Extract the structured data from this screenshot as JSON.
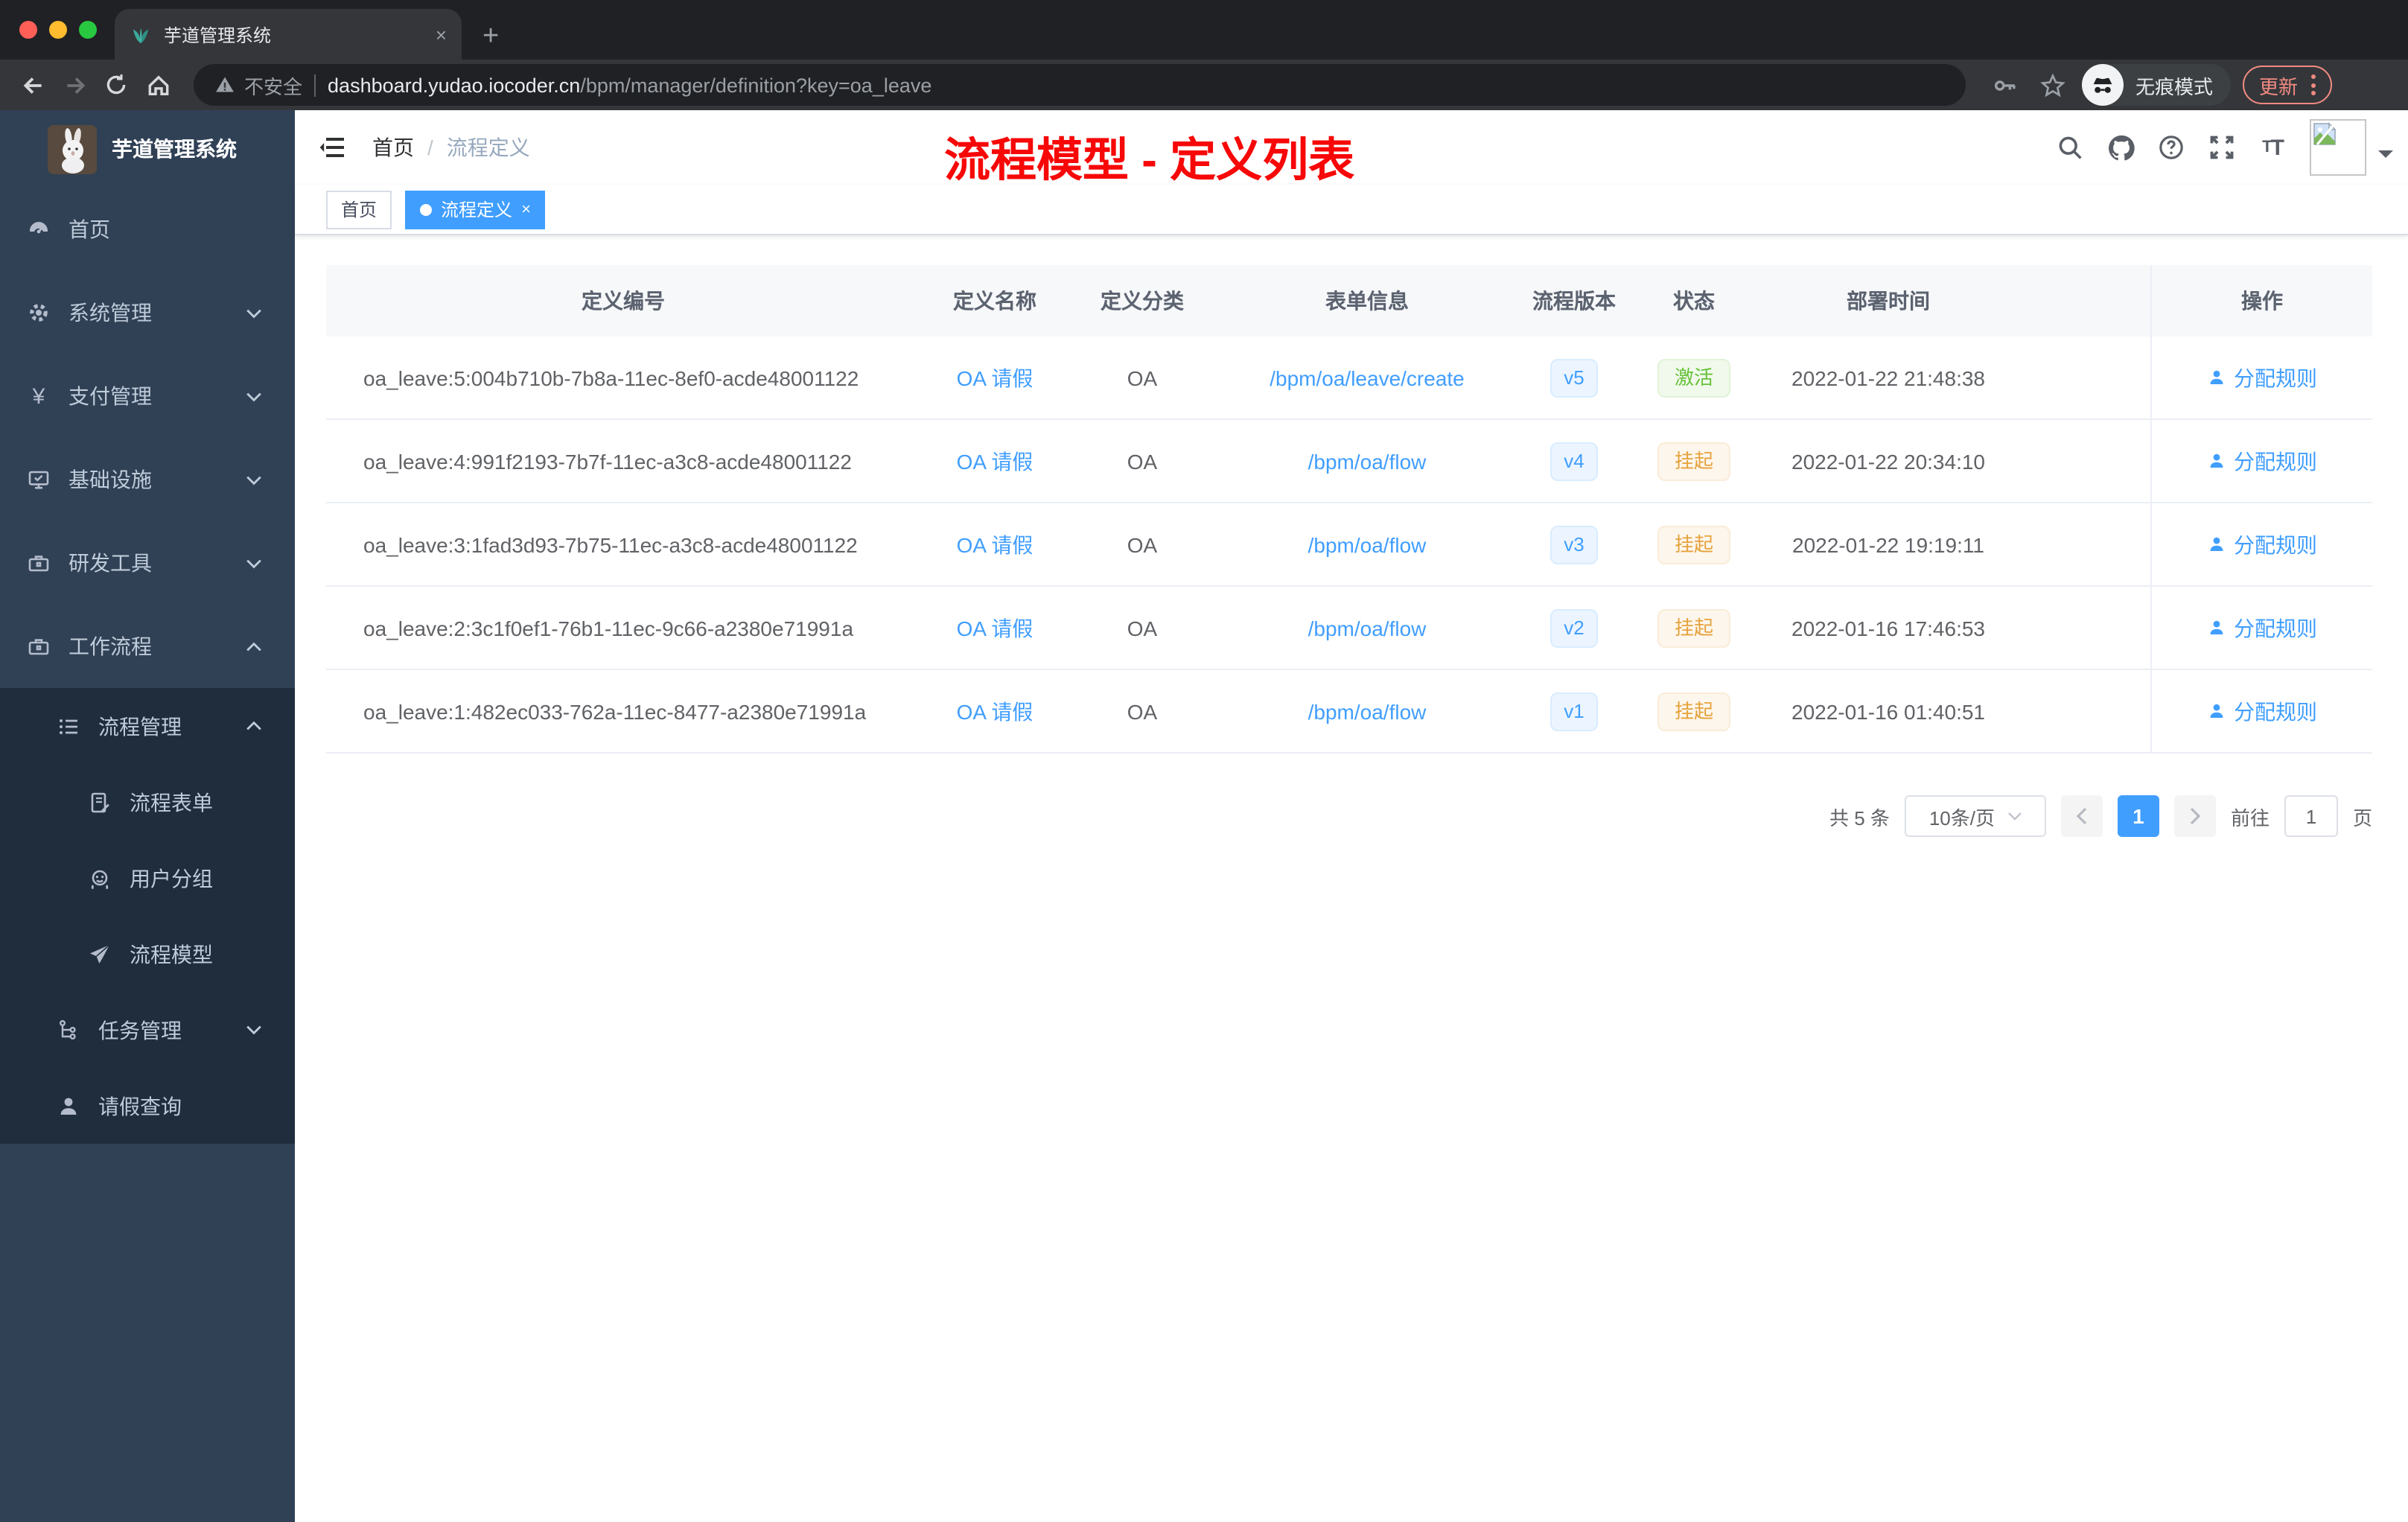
{
  "browser": {
    "tab_title": "芋道管理系统",
    "new_tab_button": "+",
    "close_tab_button": "×",
    "security_label": "不安全",
    "url_host": "dashboard.yudao.iocoder.cn",
    "url_path": "/bpm/manager/definition?key=oa_leave",
    "incognito_label": "无痕模式",
    "update_label": "更新"
  },
  "sidebar": {
    "app_title": "芋道管理系统",
    "items": [
      {
        "label": "首页"
      },
      {
        "label": "系统管理"
      },
      {
        "label": "支付管理"
      },
      {
        "label": "基础设施"
      },
      {
        "label": "研发工具"
      },
      {
        "label": "工作流程"
      },
      {
        "label": "流程管理"
      },
      {
        "label": "流程表单"
      },
      {
        "label": "用户分组"
      },
      {
        "label": "流程模型"
      },
      {
        "label": "任务管理"
      },
      {
        "label": "请假查询"
      }
    ]
  },
  "header": {
    "breadcrumb": {
      "home": "首页",
      "separator": "/",
      "current": "流程定义"
    },
    "annotation": "流程模型 - 定义列表"
  },
  "tags": {
    "home_label": "首页",
    "active_label": "流程定义",
    "close": "×"
  },
  "table": {
    "columns": {
      "id": "定义编号",
      "name": "定义名称",
      "category": "定义分类",
      "form": "表单信息",
      "version": "流程版本",
      "status": "状态",
      "time": "部署时间",
      "actions": "操作"
    },
    "action_label": "分配规则",
    "rows": [
      {
        "id": "oa_leave:5:004b710b-7b8a-11ec-8ef0-acde48001122",
        "name": "OA 请假",
        "category": "OA",
        "form": "/bpm/oa/leave/create",
        "version": "v5",
        "status": "激活",
        "time": "2022-01-22 21:48:38"
      },
      {
        "id": "oa_leave:4:991f2193-7b7f-11ec-a3c8-acde48001122",
        "name": "OA 请假",
        "category": "OA",
        "form": "/bpm/oa/flow",
        "version": "v4",
        "status": "挂起",
        "time": "2022-01-22 20:34:10"
      },
      {
        "id": "oa_leave:3:1fad3d93-7b75-11ec-a3c8-acde48001122",
        "name": "OA 请假",
        "category": "OA",
        "form": "/bpm/oa/flow",
        "version": "v3",
        "status": "挂起",
        "time": "2022-01-22 19:19:11"
      },
      {
        "id": "oa_leave:2:3c1f0ef1-76b1-11ec-9c66-a2380e71991a",
        "name": "OA 请假",
        "category": "OA",
        "form": "/bpm/oa/flow",
        "version": "v2",
        "status": "挂起",
        "time": "2022-01-16 17:46:53"
      },
      {
        "id": "oa_leave:1:482ec033-762a-11ec-8477-a2380e71991a",
        "name": "OA 请假",
        "category": "OA",
        "form": "/bpm/oa/flow",
        "version": "v1",
        "status": "挂起",
        "time": "2022-01-16 01:40:51"
      }
    ]
  },
  "pagination": {
    "total_label": "共 5 条",
    "page_size_label": "10条/页",
    "current_page": "1",
    "goto_label": "前往",
    "goto_value": "1",
    "page_unit_label": "页"
  },
  "colors": {
    "accent_blue": "#409eff",
    "success_green": "#67c23a",
    "warning_orange": "#e6a23c",
    "annotation_red": "#f70808",
    "sidebar_bg": "#304156",
    "submenu_bg": "#1f2d3d"
  }
}
